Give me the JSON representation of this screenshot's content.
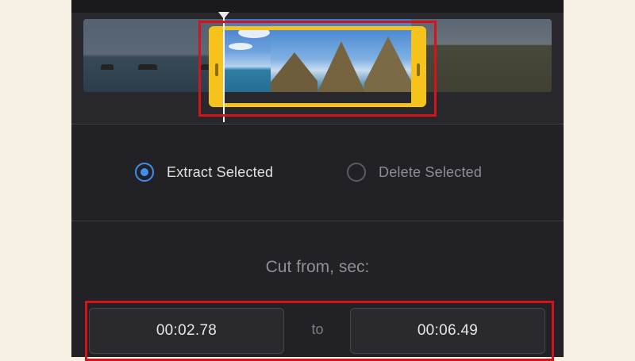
{
  "trim": {
    "extract_label": "Extract Selected",
    "delete_label": "Delete Selected",
    "selected_mode": "extract"
  },
  "cut": {
    "title": "Cut from, sec:",
    "start": "00:02.78",
    "to_label": "to",
    "end": "00:06.49"
  },
  "colors": {
    "accent": "#3e8ff0",
    "selection": "#f5c31b",
    "highlight": "#d8121b",
    "panel": "#222226",
    "page": "#f5efe4"
  }
}
